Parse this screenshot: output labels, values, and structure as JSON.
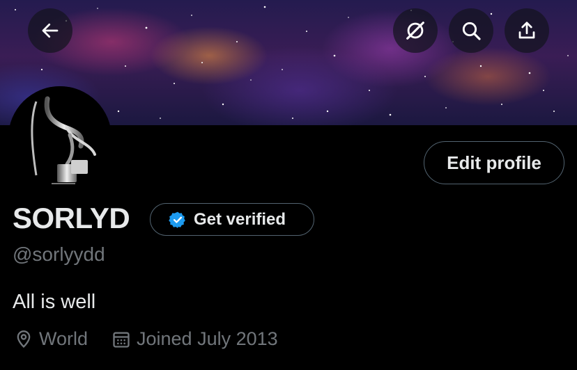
{
  "header": {
    "back_icon": "arrow-left-icon",
    "grok_icon": "grok-icon",
    "search_icon": "search-icon",
    "share_icon": "share-icon"
  },
  "profile": {
    "name": "SORLYD",
    "verify_label": "Get verified",
    "handle": "@sorlyydd",
    "bio": "All is well",
    "location": "World",
    "joined": "Joined July 2013",
    "edit_label": "Edit profile"
  },
  "colors": {
    "background": "#000000",
    "primary_text": "#e7e9ea",
    "secondary_text": "#71767b",
    "verified_blue": "#1d9bf0",
    "button_border": "#536471"
  }
}
